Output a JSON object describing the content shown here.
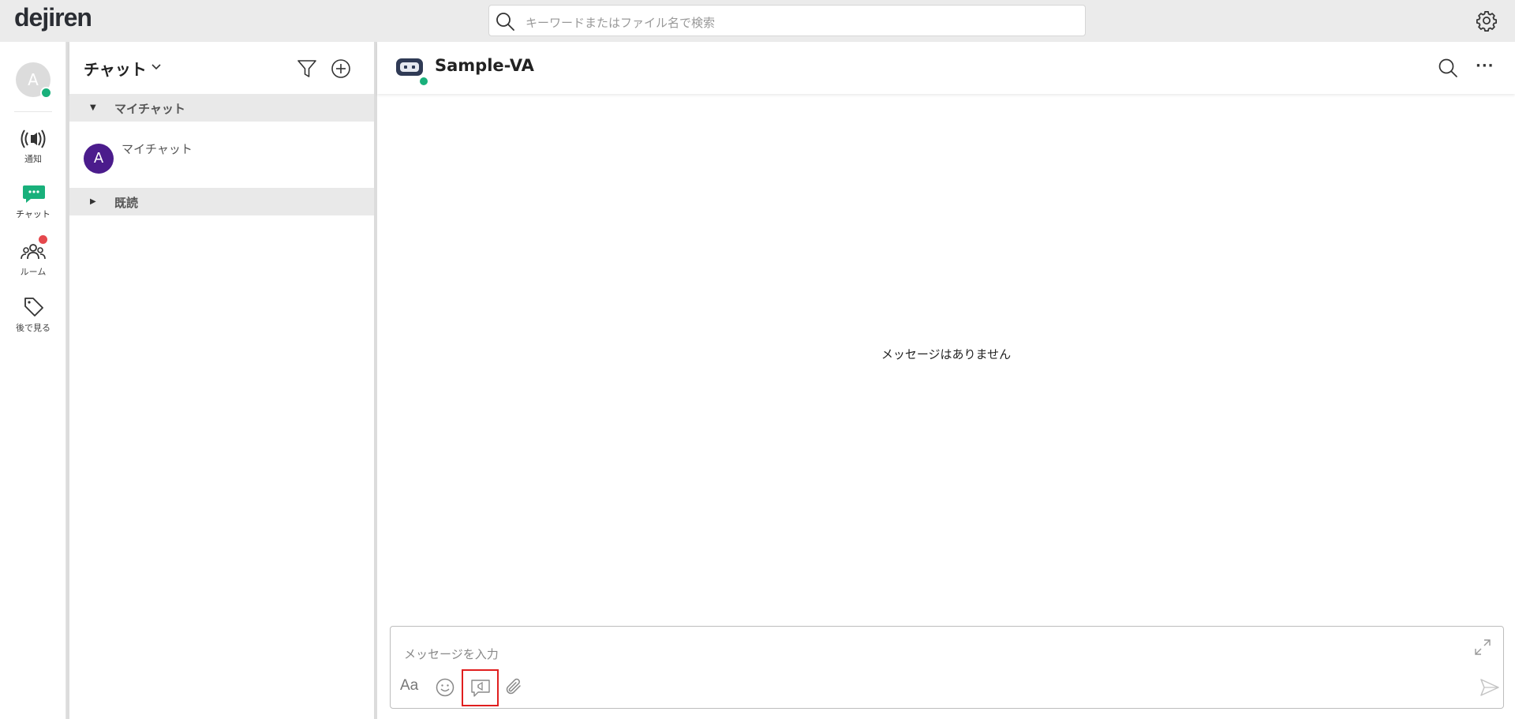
{
  "app": {
    "logo": "dejiren",
    "search_placeholder": "キーワードまたはファイル名で検索"
  },
  "nav": {
    "avatar_initial": "A",
    "items": [
      {
        "label": "通知",
        "icon": "broadcast-icon"
      },
      {
        "label": "チャット",
        "icon": "chat-icon"
      },
      {
        "label": "ルーム",
        "icon": "people-icon"
      },
      {
        "label": "後で見る",
        "icon": "tag-icon"
      }
    ]
  },
  "chatlist": {
    "title": "チャット",
    "sections": [
      {
        "label": "マイチャット",
        "expanded": true
      },
      {
        "label": "既読",
        "expanded": false
      }
    ],
    "items": [
      {
        "avatar": "A",
        "name": "マイチャット"
      }
    ]
  },
  "main": {
    "title": "Sample-VA",
    "more": "···",
    "empty_message": "メッセージはありません",
    "composer": {
      "placeholder": "メッセージを入力",
      "format_label": "Aa"
    }
  },
  "colors": {
    "accent": "#19b07b",
    "avatar": "#4b1c8c",
    "badge": "#e5484d",
    "highlight": "#e01f1f"
  }
}
